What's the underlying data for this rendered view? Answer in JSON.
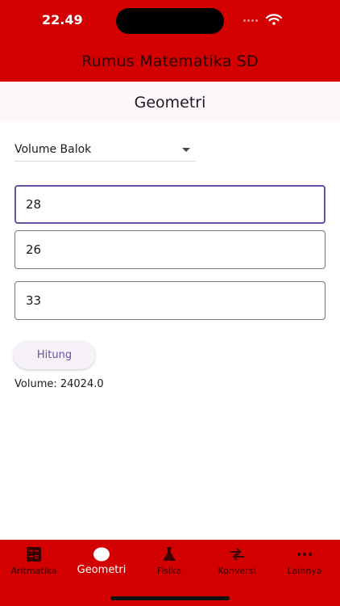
{
  "status_bar": {
    "time": "22.49"
  },
  "app_bar": {
    "title": "Rumus Matematika SD"
  },
  "section": {
    "title": "Geometri"
  },
  "dropdown": {
    "selected": "Volume Balok"
  },
  "fields": [
    "28",
    "26",
    "33"
  ],
  "actions": {
    "calculate_label": "Hitung"
  },
  "result": {
    "text": "Volume: 24024.0"
  },
  "bottom_nav": [
    {
      "label": "Aritmatika",
      "icon": "calculator-icon",
      "active": false
    },
    {
      "label": "Geometri",
      "icon": "circle-icon",
      "active": true
    },
    {
      "label": "Fisika",
      "icon": "flask-icon",
      "active": false
    },
    {
      "label": "Konversi",
      "icon": "swap-arrows-icon",
      "active": false
    },
    {
      "label": "Lainnya",
      "icon": "more-dots-icon",
      "active": false
    }
  ],
  "colors": {
    "brand": "#d20000",
    "accent": "#6750a4",
    "section_background": "#fdf6fb"
  }
}
